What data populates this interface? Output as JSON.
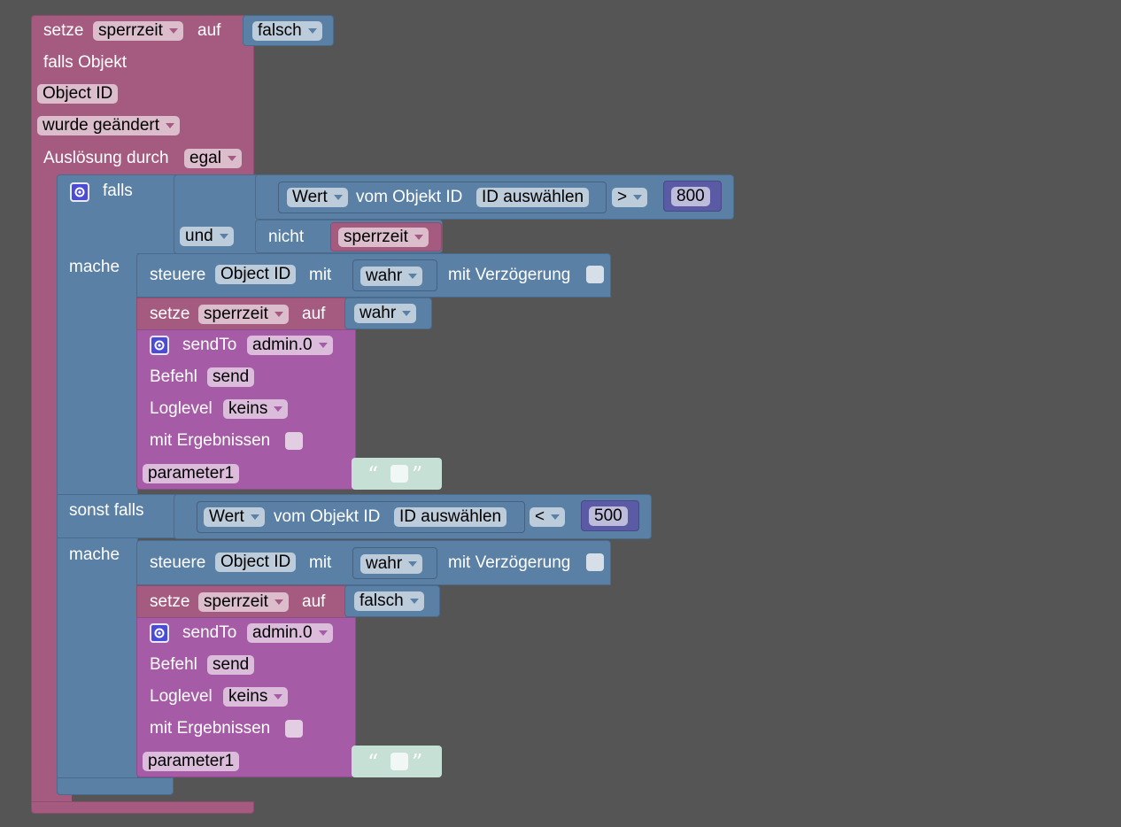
{
  "top_set": {
    "word": "setze",
    "var": "sperrzeit",
    "on": "auf",
    "value": "falsch"
  },
  "trigger": {
    "title": "falls Objekt",
    "object": "Object ID",
    "event": "wurde geändert",
    "source_label": "Auslösung durch",
    "source_value": "egal"
  },
  "if_block": {
    "falls": "falls",
    "mache1": "mache",
    "sonst_falls": "sonst falls",
    "mache2": "mache",
    "logic_op": "und",
    "nicht": "nicht",
    "nicht_var": "sperrzeit"
  },
  "cond1": {
    "wert": "Wert",
    "vom": "vom Objekt ID",
    "id": "ID auswählen",
    "op": ">",
    "num": "800"
  },
  "cond2": {
    "wert": "Wert",
    "vom": "vom Objekt ID",
    "id": "ID auswählen",
    "op": "<",
    "num": "500"
  },
  "branch1": {
    "control": {
      "word": "steuere",
      "object": "Object ID",
      "mit": "mit",
      "value": "wahr",
      "delay": "mit Verzögerung"
    },
    "set": {
      "word": "setze",
      "var": "sperrzeit",
      "on": "auf",
      "value": "wahr"
    },
    "sendto": {
      "word": "sendTo",
      "instance": "admin.0",
      "befehl": "Befehl",
      "cmd": "send",
      "loglevel": "Loglevel",
      "level": "keins",
      "results": "mit Ergebnissen",
      "param": "parameter1"
    }
  },
  "branch2": {
    "control": {
      "word": "steuere",
      "object": "Object ID",
      "mit": "mit",
      "value": "wahr",
      "delay": "mit Verzögerung"
    },
    "set": {
      "word": "setze",
      "var": "sperrzeit",
      "on": "auf",
      "value": "falsch"
    },
    "sendto": {
      "word": "sendTo",
      "instance": "admin.0",
      "befehl": "Befehl",
      "cmd": "send",
      "loglevel": "Loglevel",
      "level": "keins",
      "results": "mit Ergebnissen",
      "param": "parameter1"
    }
  },
  "colors": {
    "variables": "#a55b80",
    "logic": "#5b80a5",
    "sendto": "#a55ba5",
    "math": "#5b5ba5",
    "text": "#c6e0d6",
    "workspace": "#555555"
  }
}
